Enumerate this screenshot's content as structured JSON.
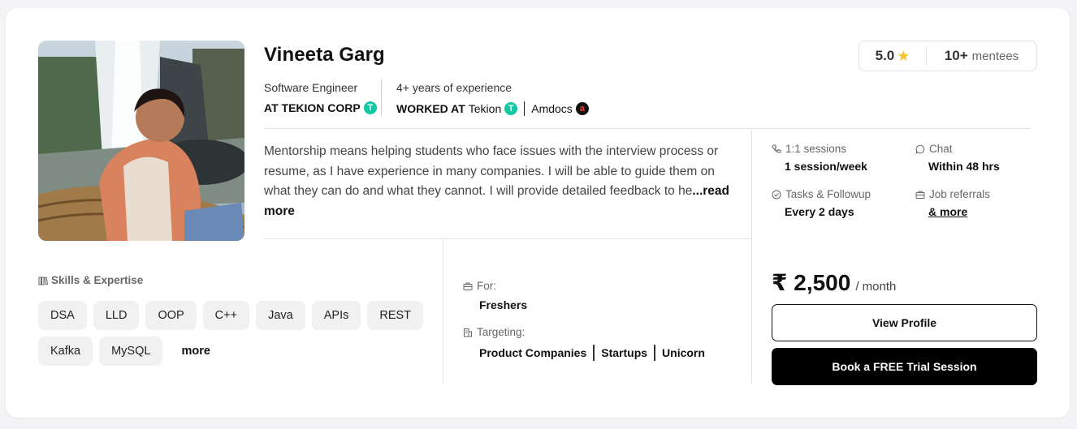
{
  "mentor": {
    "name": "Vineeta Garg",
    "role_label": "Software Engineer",
    "current_company": "AT TEKION CORP",
    "experience_label": "4+ years of experience",
    "worked_at_prefix": "WORKED AT",
    "worked_companies": [
      "Tekion",
      "Amdocs"
    ]
  },
  "rating": {
    "score": "5.0",
    "mentee_count": "10+",
    "mentee_label": "mentees"
  },
  "bio": {
    "text": "Mentorship means helping students who face issues with the interview process or resume, as I have experience in many companies. I will be able to guide them on what they can do and what they cannot. I will provide detailed feedback to he",
    "read_more": "...read more"
  },
  "stats": {
    "sessions_label": "1:1 sessions",
    "sessions_value": "1 session/week",
    "chat_label": "Chat",
    "chat_value": "Within 48 hrs",
    "tasks_label": "Tasks & Followup",
    "tasks_value": "Every 2 days",
    "referrals_label": "Job referrals",
    "referrals_value": "& more"
  },
  "skills": {
    "title": "Skills & Expertise",
    "items": [
      "DSA",
      "LLD",
      "OOP",
      "C++",
      "Java",
      "APIs",
      "REST",
      "Kafka",
      "MySQL"
    ],
    "more_label": "more"
  },
  "audience": {
    "for_label": "For:",
    "for_value": "Freshers",
    "targeting_label": "Targeting:",
    "targeting_values": [
      "Product Companies",
      "Startups",
      "Unicorn"
    ]
  },
  "pricing": {
    "amount": "₹ 2,500",
    "period": "/ month"
  },
  "actions": {
    "view_profile": "View Profile",
    "book_trial": "Book a FREE Trial Session"
  },
  "colors": {
    "tekion_brand": "#12c7a1",
    "amdocs_brand": "#ff3b3b",
    "star": "#f6c12c",
    "primary_button": "#000000"
  }
}
